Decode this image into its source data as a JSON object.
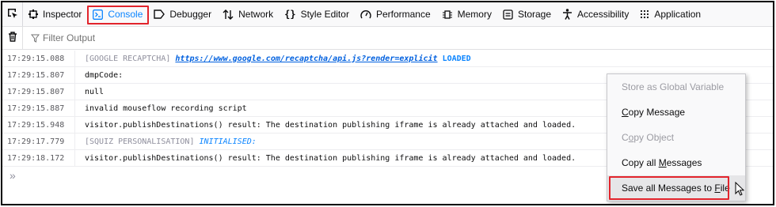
{
  "toolbar": {
    "tabs": [
      {
        "label": "Inspector",
        "icon": "inspector-icon"
      },
      {
        "label": "Console",
        "icon": "console-icon",
        "selected": true
      },
      {
        "label": "Debugger",
        "icon": "debugger-icon"
      },
      {
        "label": "Network",
        "icon": "network-icon"
      },
      {
        "label": "Style Editor",
        "icon": "style-editor-icon"
      },
      {
        "label": "Performance",
        "icon": "performance-icon"
      },
      {
        "label": "Memory",
        "icon": "memory-icon"
      },
      {
        "label": "Storage",
        "icon": "storage-icon"
      },
      {
        "label": "Accessibility",
        "icon": "accessibility-icon"
      },
      {
        "label": "Application",
        "icon": "application-icon"
      }
    ]
  },
  "filter": {
    "placeholder": "Filter Output"
  },
  "log": {
    "rows": [
      {
        "time": "17:29:15.088",
        "prefix": "[GOOGLE RECAPTCHA]",
        "link": "https://www.google.com/recaptcha/api.js?render=explicit",
        "suffix": "LOADED"
      },
      {
        "time": "17:29:15.807",
        "text": "dmpCode:"
      },
      {
        "time": "17:29:15.807",
        "text": "null"
      },
      {
        "time": "17:29:15.887",
        "text": "invalid mouseflow recording script"
      },
      {
        "time": "17:29:15.948",
        "text": "visitor.publishDestinations() result: The destination publishing iframe is already attached and loaded."
      },
      {
        "time": "17:29:17.779",
        "prefix": "[SQUIZ PERSONALISATION]",
        "suffix": "INITIALISED:"
      },
      {
        "time": "17:29:18.172",
        "text": "visitor.publishDestinations() result: The destination publishing iframe is already attached and loaded."
      }
    ],
    "prompt": "»"
  },
  "context_menu": {
    "items": [
      {
        "label": "Store as Global Variable",
        "disabled": true
      },
      {
        "label_pre": "",
        "label_u": "C",
        "label_post": "opy Message",
        "disabled": false
      },
      {
        "label_pre": "C",
        "label_u": "o",
        "label_post": "py Object",
        "disabled": true
      },
      {
        "label_pre": "Copy all ",
        "label_u": "M",
        "label_post": "essages",
        "disabled": false
      },
      {
        "label_pre": "Save all Messages to ",
        "label_u": "F",
        "label_post": "ile",
        "disabled": false,
        "highlighted": true
      }
    ]
  },
  "colors": {
    "accent": "#0a84ff",
    "highlight_box": "#e2242c"
  }
}
